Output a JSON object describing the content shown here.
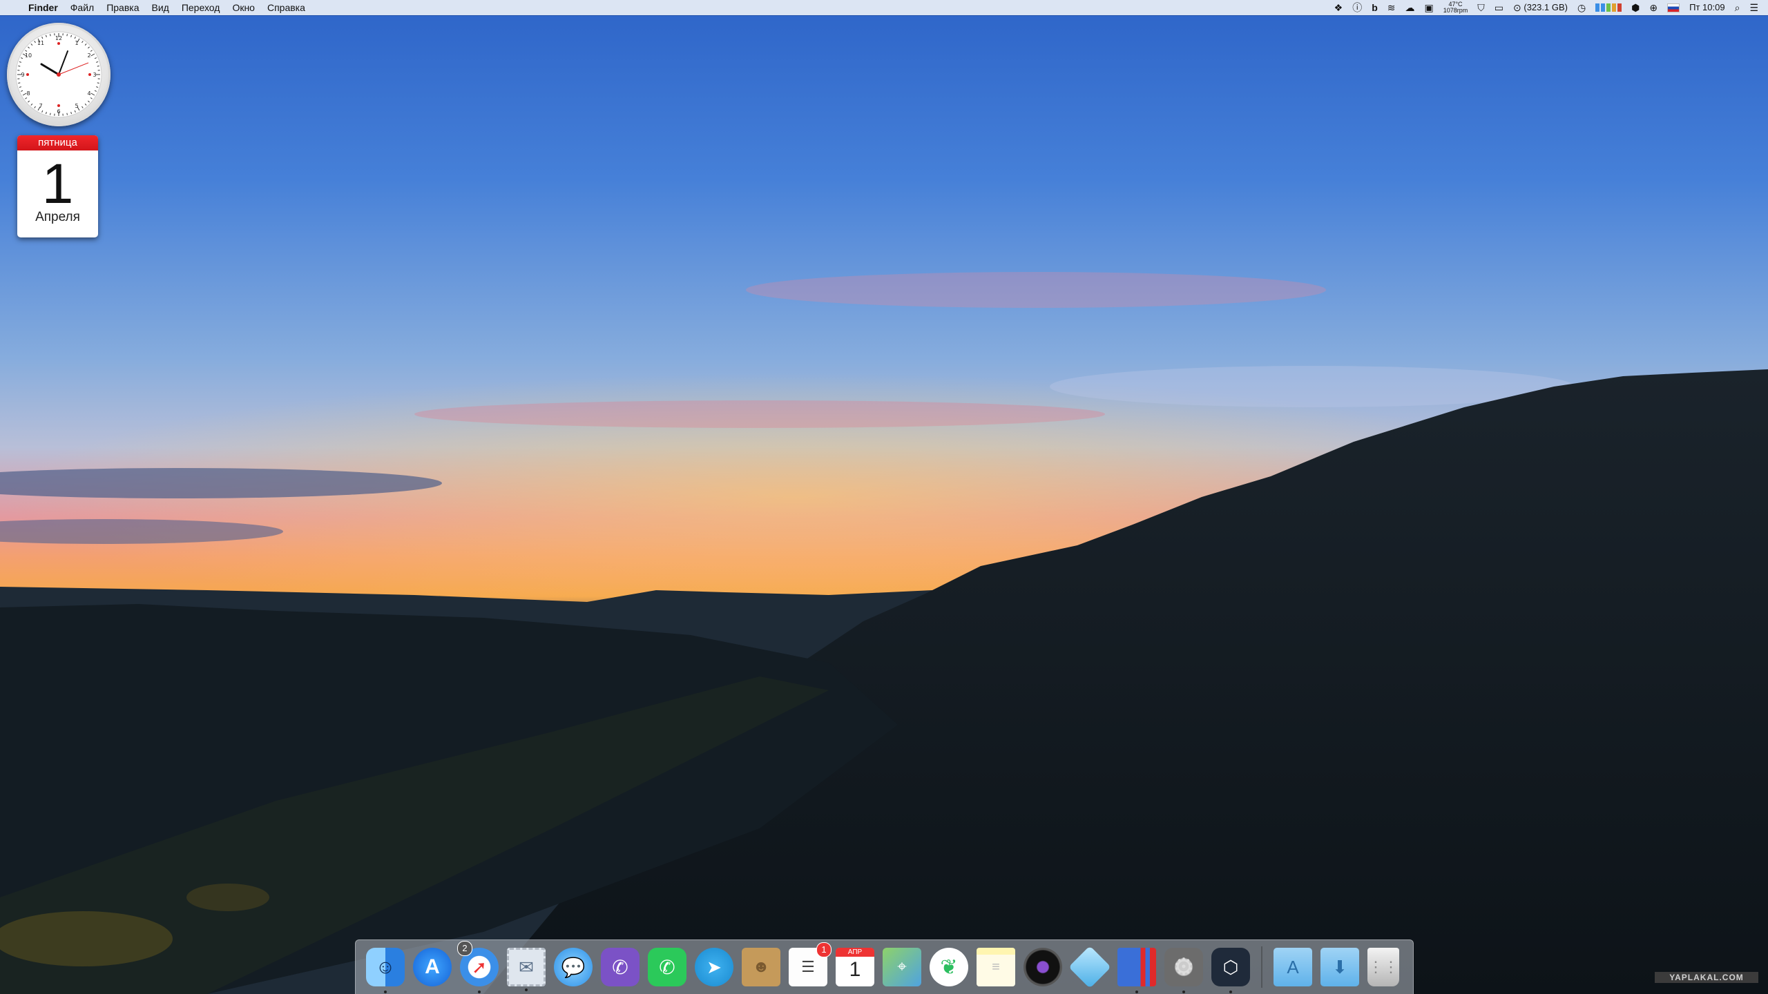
{
  "menubar": {
    "apple_icon": "apple-icon",
    "app_name": "Finder",
    "menus": [
      "Файл",
      "Правка",
      "Вид",
      "Переход",
      "Окно",
      "Справка"
    ],
    "status": {
      "temperature": "47°C",
      "fan": "1078rpm",
      "disk": "(323.1 GB)",
      "clock": "Пт 10:09"
    }
  },
  "calendar_widget": {
    "weekday": "пятница",
    "day": "1",
    "month": "Апреля"
  },
  "dock": {
    "apps": [
      {
        "name": "Finder",
        "icon": "finder-icon"
      },
      {
        "name": "App Store",
        "icon": "app-store-icon"
      },
      {
        "name": "Safari",
        "icon": "safari-icon",
        "badge": "2"
      },
      {
        "name": "Mail",
        "icon": "mail-stamp-icon"
      },
      {
        "name": "Messages",
        "icon": "messages-icon"
      },
      {
        "name": "Viber",
        "icon": "viber-icon"
      },
      {
        "name": "WhatsApp",
        "icon": "whatsapp-icon"
      },
      {
        "name": "Telegram",
        "icon": "telegram-icon"
      },
      {
        "name": "Contacts",
        "icon": "contacts-icon"
      },
      {
        "name": "Reminders",
        "icon": "reminders-icon",
        "badge": "1"
      },
      {
        "name": "Calendar",
        "icon": "calendar-icon",
        "cal_month": "АПР",
        "cal_day": "1"
      },
      {
        "name": "Maps",
        "icon": "maps-icon"
      },
      {
        "name": "Evernote",
        "icon": "evernote-icon"
      },
      {
        "name": "Notes",
        "icon": "notes-icon"
      },
      {
        "name": "Photo Booth",
        "icon": "camera-icon"
      },
      {
        "name": "Box",
        "icon": "box-icon"
      },
      {
        "name": "Parallels",
        "icon": "parallels-icon"
      },
      {
        "name": "System Preferences",
        "icon": "gear-icon"
      },
      {
        "name": "Codelobster",
        "icon": "hexagon-app-icon"
      }
    ],
    "folders": [
      {
        "name": "Applications",
        "icon": "applications-folder-icon"
      },
      {
        "name": "Downloads",
        "icon": "downloads-folder-icon"
      },
      {
        "name": "Trash",
        "icon": "trash-icon"
      }
    ]
  },
  "watermark": "YAPLAKAL.COM"
}
